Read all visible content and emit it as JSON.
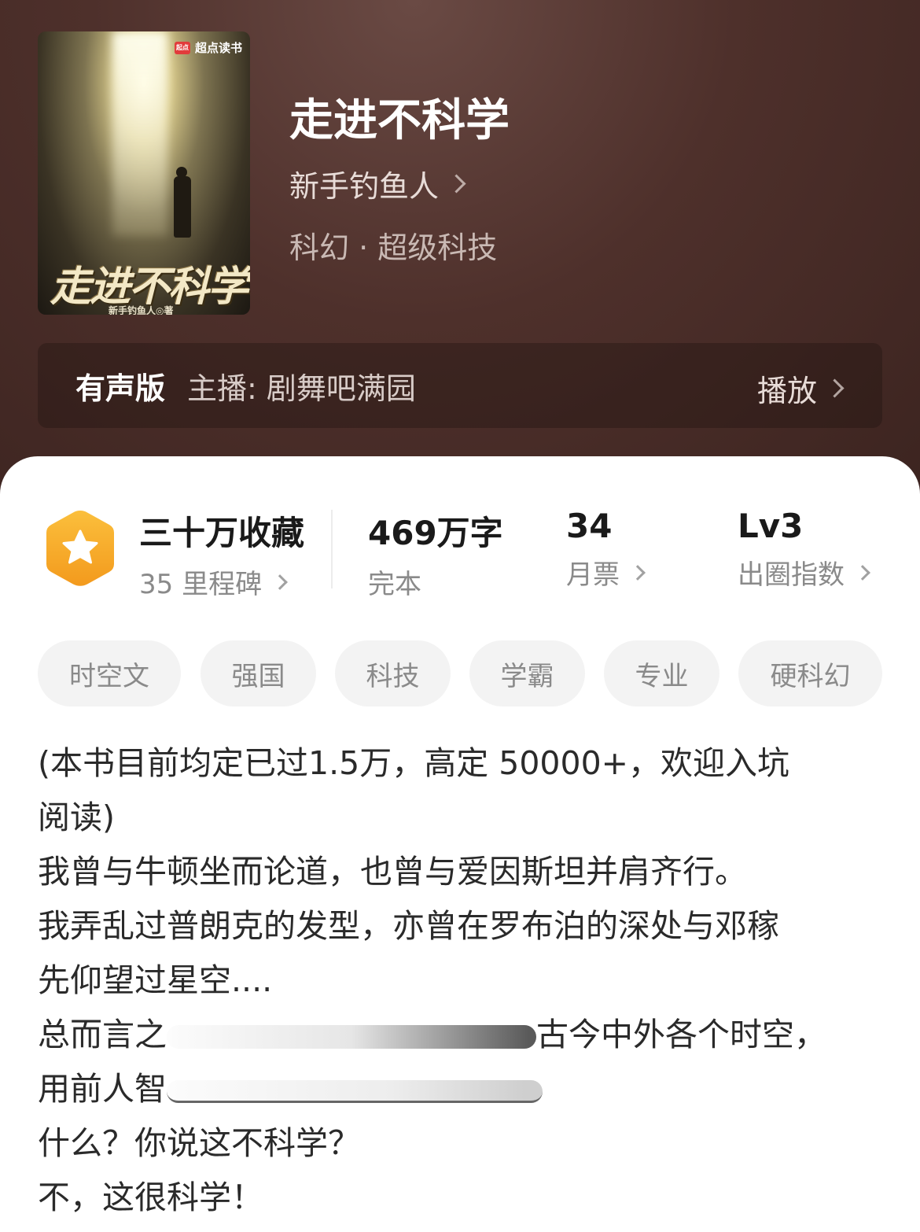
{
  "cover": {
    "brand": "超点读书",
    "brand_logo": "起点",
    "title": "走进不科学",
    "author": "新手钓鱼人◎著"
  },
  "book": {
    "title": "走进不科学",
    "author": "新手钓鱼人",
    "genre": "科幻 · 超级科技"
  },
  "audio": {
    "label": "有声版",
    "host": "主播: 剧舞吧满园",
    "play": "播放"
  },
  "stats": {
    "collect_main": "三十万收藏",
    "collect_sub": "35 里程碑",
    "words_main": "469万字",
    "words_sub": "完本",
    "tickets_main": "34",
    "tickets_sub": "月票",
    "level_main": "Lv3",
    "level_sub": "出圈指数"
  },
  "tags": [
    "时空文",
    "强国",
    "科技",
    "学霸",
    "专业",
    "硬科幻"
  ],
  "description": {
    "line1": "(本书目前均定已过1.5万，高定 50000+，欢迎入坑",
    "line2": "阅读)",
    "line3": "我曾与牛顿坐而论道，也曾与爱因斯坦并肩齐行。",
    "line4": "我弄乱过普朗克的发型，亦曾在罗布泊的深处与邓稼",
    "line5": "先仰望过星空....",
    "line6a": "总而言之",
    "line6b": "古今中外各个时空，",
    "line7a": "用前人智",
    "line8": "什么？你说这不科学？",
    "line9": "不，这很科学！"
  },
  "colors": {
    "header_bg": "#4e302b",
    "badge_orange": "#f5a623",
    "text_dark": "#1a1a1a",
    "text_gray": "#8a8a8a"
  }
}
